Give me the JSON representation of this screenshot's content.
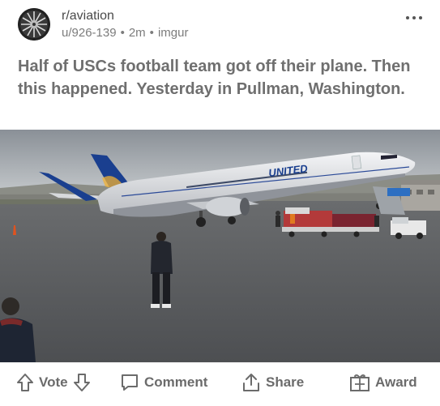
{
  "post": {
    "subreddit": "r/aviation",
    "author": "u/926-139",
    "time": "2m",
    "source": "imgur",
    "separator": "•",
    "title": "Half of USCs football team got off their plane. Then this happened. Yesterday in Pullman, Washington."
  },
  "image": {
    "fuselage_text": "UNITED"
  },
  "actions": {
    "vote_label": "Vote",
    "comment_label": "Comment",
    "share_label": "Share",
    "award_label": "Award"
  },
  "icons": {
    "avatar": "turbofan-engine-icon",
    "more": "more-options-icon",
    "upvote": "arrow-up-icon",
    "downvote": "arrow-down-icon",
    "comment": "comment-bubble-icon",
    "share": "share-icon",
    "award": "gift-icon"
  },
  "colors": {
    "title": "#6f6f6f",
    "meta": "#7c7c7c",
    "action": "#6b6b6b",
    "united_blue": "#1a3f8f"
  }
}
